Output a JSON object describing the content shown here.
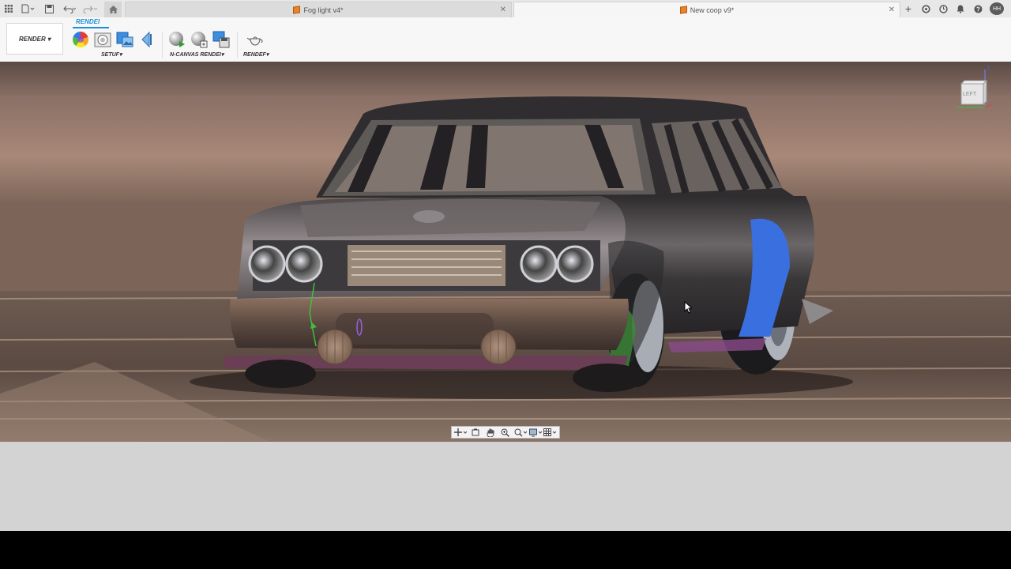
{
  "tabs": [
    {
      "label": "Fog light v4*",
      "active": false
    },
    {
      "label": "New coop v9*",
      "active": true
    }
  ],
  "quick_access": [
    "apps-grid-icon",
    "file-menu-icon",
    "save-icon",
    "undo-icon",
    "redo-icon",
    "home-icon"
  ],
  "tray": [
    "add-tab-icon",
    "refresh-icon",
    "clock-icon",
    "bell-icon",
    "help-icon"
  ],
  "user": {
    "initials": "HH"
  },
  "ribbon": {
    "workspace_label": "RENDER ▾",
    "active_tab": "RENDEI",
    "groups": [
      {
        "label": "SETUF▾",
        "tools": [
          "appearance-icon",
          "scene-settings-icon",
          "texture-map-icon",
          "decal-icon"
        ]
      },
      {
        "label": "N-CANVAS RENDEI▾",
        "tools": [
          "in-canvas-render-icon",
          "render-settings-icon",
          "capture-image-icon"
        ]
      },
      {
        "label": "RENDEF▾",
        "tools": [
          "render-teapot-icon"
        ]
      }
    ]
  },
  "viewcube": {
    "face_label": "LEFT",
    "axis_label": "Z"
  },
  "nav_bar": [
    "orbit-icon",
    "look-at-icon",
    "pan-icon",
    "zoom-icon",
    "fit-icon",
    "display-settings-icon",
    "grid-settings-icon"
  ],
  "colors": {
    "accent": "#1a8fd6",
    "tab_icon": "#e8832a"
  }
}
